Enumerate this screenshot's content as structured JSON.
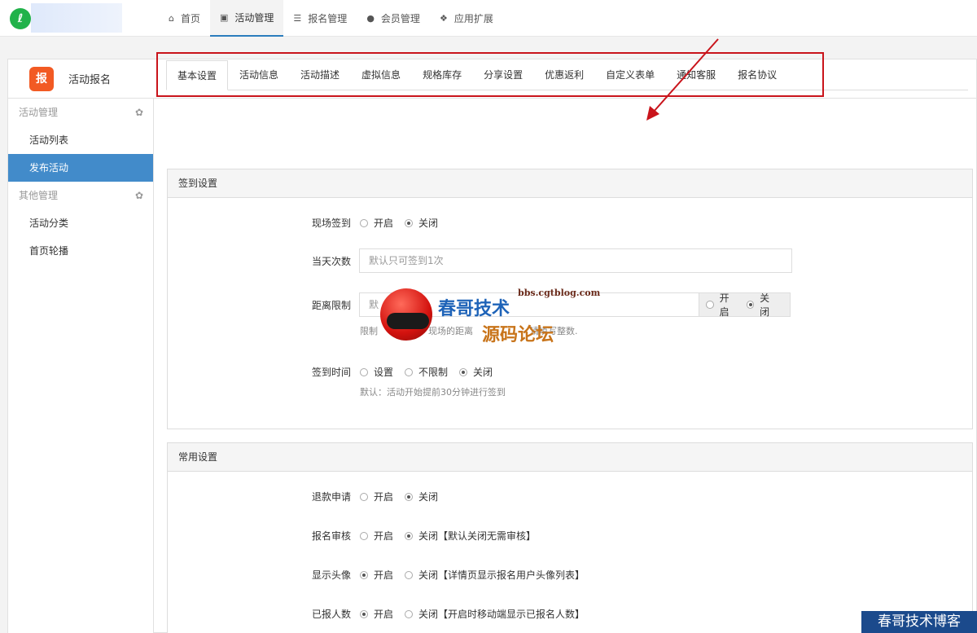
{
  "topnav": {
    "items": [
      {
        "label": "首页",
        "icon": "home-icon"
      },
      {
        "label": "活动管理",
        "icon": "gift-icon",
        "active": true
      },
      {
        "label": "报名管理",
        "icon": "list-icon"
      },
      {
        "label": "会员管理",
        "icon": "user-icon"
      },
      {
        "label": "应用扩展",
        "icon": "cubes-icon"
      }
    ]
  },
  "panel": {
    "title": "活动报名",
    "app_icon_text": "报"
  },
  "sidebar": {
    "groups": [
      {
        "label": "活动管理",
        "items": [
          "活动列表",
          "发布活动"
        ]
      },
      {
        "label": "其他管理",
        "items": [
          "活动分类",
          "首页轮播"
        ]
      }
    ],
    "active_item": "发布活动"
  },
  "tabs": [
    "基本设置",
    "活动信息",
    "活动描述",
    "虚拟信息",
    "规格库存",
    "分享设置",
    "优惠返利",
    "自定义表单",
    "通知客服",
    "报名协议"
  ],
  "active_tab": "基本设置",
  "signin_section": {
    "title": "签到设置",
    "onsite": {
      "label": "现场签到",
      "options": [
        "开启",
        "关闭"
      ],
      "selected": "关闭"
    },
    "daily_count": {
      "label": "当天次数",
      "placeholder": "默认只可签到1次"
    },
    "distance": {
      "label": "距离限制",
      "placeholder": "默",
      "options": [
        "开启",
        "关闭"
      ],
      "selected": "关闭",
      "help_left": "限制",
      "help_right": "现场的距离",
      "help_tail": "请填写整数."
    },
    "signin_time": {
      "label": "签到时间",
      "options": [
        "设置",
        "不限制",
        "关闭"
      ],
      "selected": "关闭",
      "help": "默认：活动开始提前30分钟进行签到"
    }
  },
  "common_section": {
    "title": "常用设置",
    "rows": [
      {
        "label": "退款申请",
        "options": [
          "开启",
          "关闭"
        ],
        "selected": "关闭"
      },
      {
        "label": "报名审核",
        "options": [
          "开启",
          "关闭【默认关闭无需审核】"
        ],
        "selected": "关闭【默认关闭无需审核】"
      },
      {
        "label": "显示头像",
        "options": [
          "开启",
          "关闭【详情页显示报名用户头像列表】"
        ],
        "selected": "开启"
      },
      {
        "label": "已报人数",
        "options": [
          "开启",
          "关闭【开启时移动端显示已报名人数】"
        ],
        "selected": "开启"
      }
    ]
  },
  "watermark": {
    "url": "bbs.cgtblog.com",
    "line1": "春哥技术",
    "line2": "源码论坛",
    "corner": "春哥技术博客"
  },
  "colors": {
    "accent": "#428bca",
    "highlight_box": "#c9141b"
  }
}
